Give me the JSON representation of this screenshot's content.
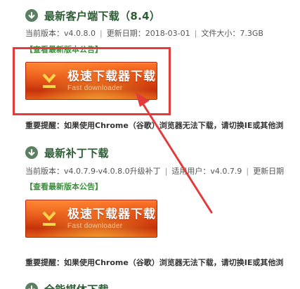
{
  "sections": [
    {
      "title": "最新客户端下载（8.4）",
      "meta": {
        "version": "当前版本：v4.0.8.0",
        "date": "更新日期：2018-03-01",
        "size": "文件大小：7.3GB"
      },
      "notice": "【查看最新版本公告】",
      "button": {
        "label": "极速下载器下载",
        "sublabel": "Fast downloader"
      },
      "warning": "重要提醒：如果使用Chrome（谷歌）浏览器无法下载，请切换IE或其他浏"
    },
    {
      "title": "最新补丁下载",
      "meta": {
        "version": "当前版本：v4.0.7.9-v4.0.8.0升级补丁",
        "users": "适用用户：v4.0.7.9",
        "date": "更新日期"
      },
      "notice": "【查看最新版本公告】",
      "button": {
        "label": "极速下载器下载",
        "sublabel": "Fast downloader"
      },
      "warning": "重要提醒：如果使用Chrome（谷歌）浏览器无法下载，请切换IE或其他浏"
    },
    {
      "title": "全能媒体下载"
    }
  ],
  "colors": {
    "section_title": "#2b5c34",
    "notice_link": "#3e8e3e",
    "button_orange": "#e04a12",
    "annotation_red": "#e23b3b"
  },
  "icons": {
    "section_icon": "download-circle-icon",
    "button_icon": "download-arrow-icon",
    "annotation": "red-pointer-arrow"
  }
}
